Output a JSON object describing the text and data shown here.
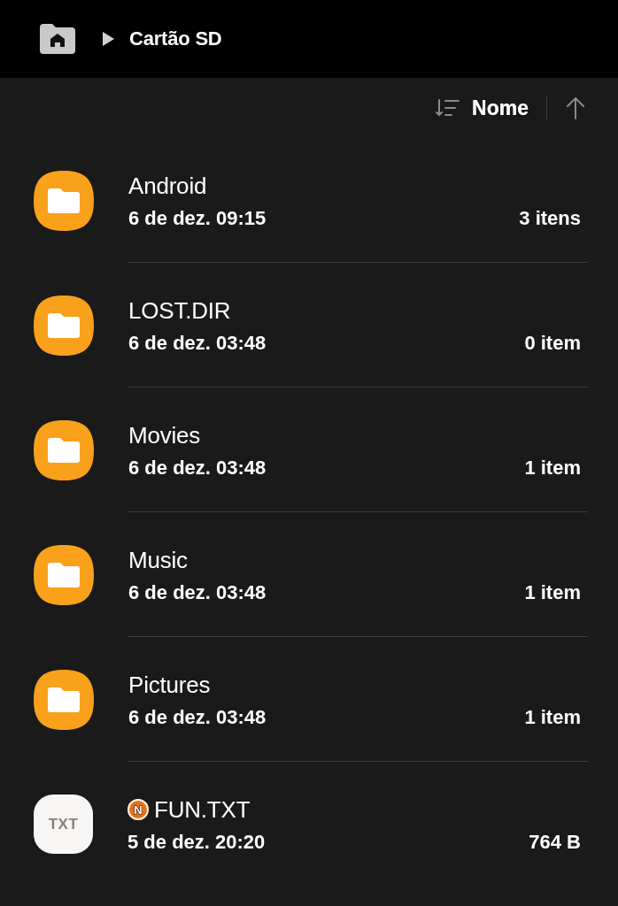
{
  "header": {
    "breadcrumb": "Cartão SD"
  },
  "sort": {
    "label": "Nome",
    "ascending": true
  },
  "files": [
    {
      "kind": "folder",
      "name": "Android",
      "date": "6 de dez. 09:15",
      "size": "3 itens"
    },
    {
      "kind": "folder",
      "name": "LOST.DIR",
      "date": "6 de dez. 03:48",
      "size": "0 item"
    },
    {
      "kind": "folder",
      "name": "Movies",
      "date": "6 de dez. 03:48",
      "size": "1 item"
    },
    {
      "kind": "folder",
      "name": "Music",
      "date": "6 de dez. 03:48",
      "size": "1 item"
    },
    {
      "kind": "folder",
      "name": "Pictures",
      "date": "6 de dez. 03:48",
      "size": "1 item"
    },
    {
      "kind": "text",
      "icon_label": "TXT",
      "badge": "N",
      "name": "FUN.TXT",
      "date": "5 de dez. 20:20",
      "size": "764 B"
    }
  ]
}
